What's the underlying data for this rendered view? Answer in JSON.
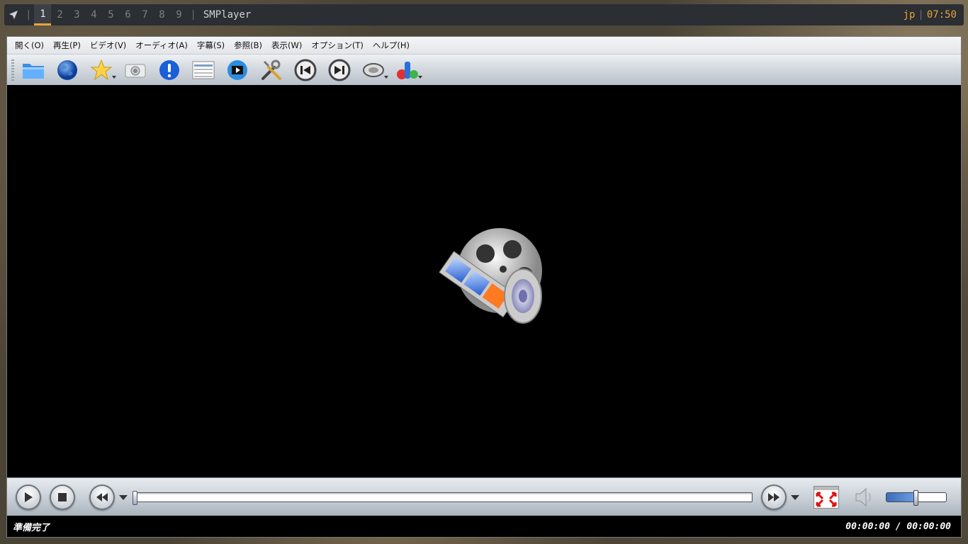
{
  "panel": {
    "workspaces": [
      "1",
      "2",
      "3",
      "4",
      "5",
      "6",
      "7",
      "8",
      "9"
    ],
    "active_workspace": "1",
    "window_title": "SMPlayer",
    "keyboard_layout": "jp",
    "clock": "07:50",
    "separator": "|"
  },
  "menubar": {
    "items": [
      "開く(O)",
      "再生(P)",
      "ビデオ(V)",
      "オーディオ(A)",
      "字幕(S)",
      "参照(B)",
      "表示(W)",
      "オプション(T)",
      "ヘルプ(H)"
    ]
  },
  "toolbar": {
    "icons": [
      "folder-icon",
      "globe-icon",
      "favorites-star-icon",
      "screenshot-camera-icon",
      "info-icon",
      "playlist-icon",
      "video-equalizer-icon",
      "preferences-tools-icon",
      "previous-track-icon",
      "next-track-icon",
      "audio-track-icon",
      "subtitle-track-icon"
    ]
  },
  "controls": {
    "seek_position": 0,
    "volume_fraction": 0.48
  },
  "status": {
    "message": "準備完了",
    "time": "00:00:00 / 00:00:00"
  },
  "colors": {
    "accent": "#e6a53a",
    "panel_bg": "#2b2e33"
  }
}
